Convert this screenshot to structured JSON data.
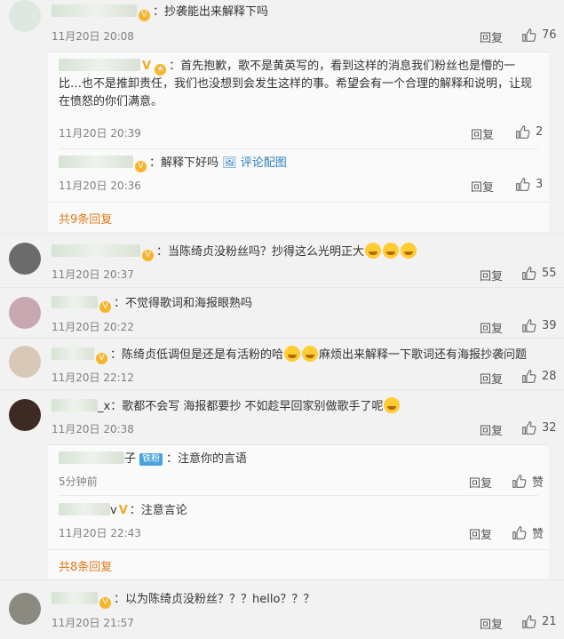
{
  "comments": [
    {
      "text": "：抄袭能出来解释下吗",
      "time": "11月20日 20:08",
      "reply": "回复",
      "likes": "76"
    },
    {
      "text": "：首先抱歉，歌不是黄英写的，看到这样的消息我们粉丝也是懵的一比…也不是推卸责任，我们也没想到会发生这样的事。希望会有一个合理的解释和说明，让现在愤怒的你们满意。",
      "time": "11月20日 20:39",
      "reply": "回复",
      "likes": "2"
    },
    {
      "text": "：解释下好吗",
      "link": "评论配图",
      "time": "11月20日 20:36",
      "reply": "回复",
      "likes": "3"
    },
    {
      "more": "共9条回复"
    },
    {
      "text": "：当陈绮贞没粉丝吗？抄得这么光明正大",
      "time": "11月20日 20:37",
      "reply": "回复",
      "likes": "55"
    },
    {
      "text": "：不觉得歌词和海报眼熟吗",
      "time": "11月20日 20:22",
      "reply": "回复",
      "likes": "39"
    },
    {
      "text": "：陈绮贞低调但是还是有活粉的哈",
      "text2": "麻烦出来解释一下歌词还有海报抄袭问题",
      "time": "11月20日 22:12",
      "reply": "回复",
      "likes": "28"
    },
    {
      "name_suffix": "_x",
      "text": "：歌都不会写 海报都要抄 不如趁早回家别做歌手了呢",
      "time": "11月20日 20:38",
      "reply": "回复",
      "likes": "32"
    },
    {
      "name_suffix": "子",
      "badge": "铁粉",
      "text": "：注意你的言语",
      "time": "5分钟前",
      "reply": "回复",
      "likes": "赞"
    },
    {
      "name_suffix": "v",
      "text": "：注意言论",
      "time": "11月20日 22:43",
      "reply": "回复",
      "likes": "赞"
    },
    {
      "more": "共8条回复"
    },
    {
      "text": "：以为陈绮贞没粉丝？？？hello？？？",
      "time": "11月20日 21:57",
      "reply": "回复",
      "likes": "21"
    }
  ],
  "colors": {
    "accent": "#e07b1f",
    "link": "#2b7dbc",
    "vip": "#f8b42b"
  },
  "icons": {
    "like": "thumbs-up-icon",
    "vip": "vip-icon",
    "emoji": "grin-emoji-icon"
  }
}
